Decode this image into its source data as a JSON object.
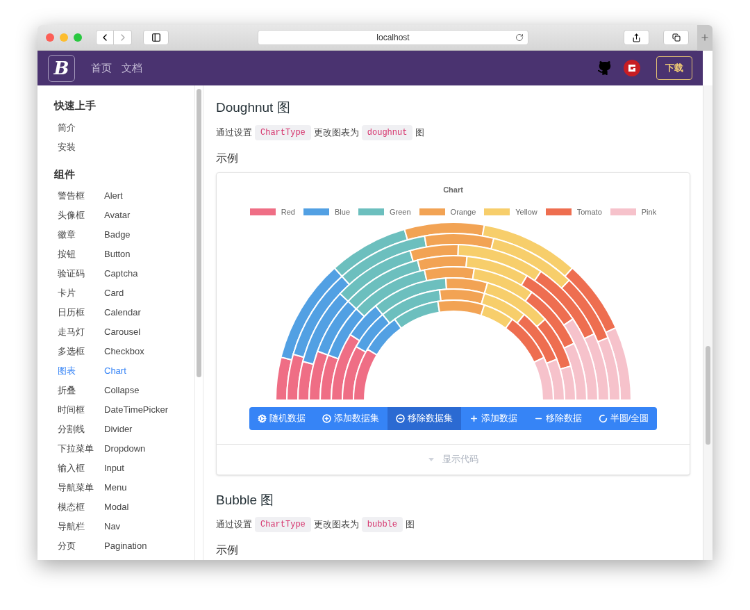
{
  "browser": {
    "address": "localhost"
  },
  "navbar": {
    "logo": "B",
    "links": [
      "首页",
      "文档"
    ],
    "download": "下载"
  },
  "sidebar": {
    "sections": [
      {
        "title": "快速上手",
        "items": [
          {
            "zh": "简介",
            "selected": false
          },
          {
            "zh": "安装",
            "selected": false
          }
        ]
      },
      {
        "title": "组件",
        "items": [
          {
            "zh": "警告框",
            "en": "Alert",
            "selected": false
          },
          {
            "zh": "头像框",
            "en": "Avatar",
            "selected": false
          },
          {
            "zh": "徽章",
            "en": "Badge",
            "selected": false
          },
          {
            "zh": "按钮",
            "en": "Button",
            "selected": false
          },
          {
            "zh": "验证码",
            "en": "Captcha",
            "selected": false
          },
          {
            "zh": "卡片",
            "en": "Card",
            "selected": false
          },
          {
            "zh": "日历框",
            "en": "Calendar",
            "selected": false
          },
          {
            "zh": "走马灯",
            "en": "Carousel",
            "selected": false
          },
          {
            "zh": "多选框",
            "en": "Checkbox",
            "selected": false
          },
          {
            "zh": "图表",
            "en": "Chart",
            "selected": true
          },
          {
            "zh": "折叠",
            "en": "Collapse",
            "selected": false
          },
          {
            "zh": "时间框",
            "en": "DateTimePicker",
            "selected": false
          },
          {
            "zh": "分割线",
            "en": "Divider",
            "selected": false
          },
          {
            "zh": "下拉菜单",
            "en": "Dropdown",
            "selected": false
          },
          {
            "zh": "输入框",
            "en": "Input",
            "selected": false
          },
          {
            "zh": "导航菜单",
            "en": "Menu",
            "selected": false
          },
          {
            "zh": "模态框",
            "en": "Modal",
            "selected": false
          },
          {
            "zh": "导航栏",
            "en": "Nav",
            "selected": false
          },
          {
            "zh": "分页",
            "en": "Pagination",
            "selected": false
          }
        ]
      }
    ]
  },
  "sections": [
    {
      "title": "Doughnut 图",
      "description": [
        {
          "kind": "text",
          "text": "通过设置"
        },
        {
          "kind": "code",
          "text": "ChartType"
        },
        {
          "kind": "text",
          "text": "更改图表为"
        },
        {
          "kind": "code",
          "text": "doughnut"
        },
        {
          "kind": "text",
          "text": "图"
        }
      ],
      "example_title": "示例",
      "example": {
        "chart_title": "Chart",
        "legend": [
          {
            "label": "Red",
            "color": "#ef6e85"
          },
          {
            "label": "Blue",
            "color": "#52a0e3"
          },
          {
            "label": "Green",
            "color": "#6cbfbe"
          },
          {
            "label": "Orange",
            "color": "#f2a354"
          },
          {
            "label": "Yellow",
            "color": "#f7ce6b"
          },
          {
            "label": "Tomato",
            "color": "#ee6e50"
          },
          {
            "label": "Pink",
            "color": "#f6c2cb"
          }
        ],
        "buttons": [
          {
            "kind": "randomize",
            "label": "随机数据",
            "selected": false
          },
          {
            "kind": "addset",
            "label": "添加数据集",
            "selected": false
          },
          {
            "kind": "removeset",
            "label": "移除数据集",
            "selected": true
          },
          {
            "kind": "add",
            "label": "添加数据",
            "selected": false
          },
          {
            "kind": "remove",
            "label": "移除数据",
            "selected": false
          },
          {
            "kind": "toggle",
            "label": "半圆/全圆",
            "selected": false
          }
        ],
        "show_code": "显示代码"
      }
    },
    {
      "title": "Bubble 图",
      "description": [
        {
          "kind": "text",
          "text": "通过设置"
        },
        {
          "kind": "code",
          "text": "ChartType"
        },
        {
          "kind": "text",
          "text": "更改图表为"
        },
        {
          "kind": "code",
          "text": "bubble"
        },
        {
          "kind": "text",
          "text": "图"
        }
      ],
      "example_title": "示例"
    }
  ]
}
